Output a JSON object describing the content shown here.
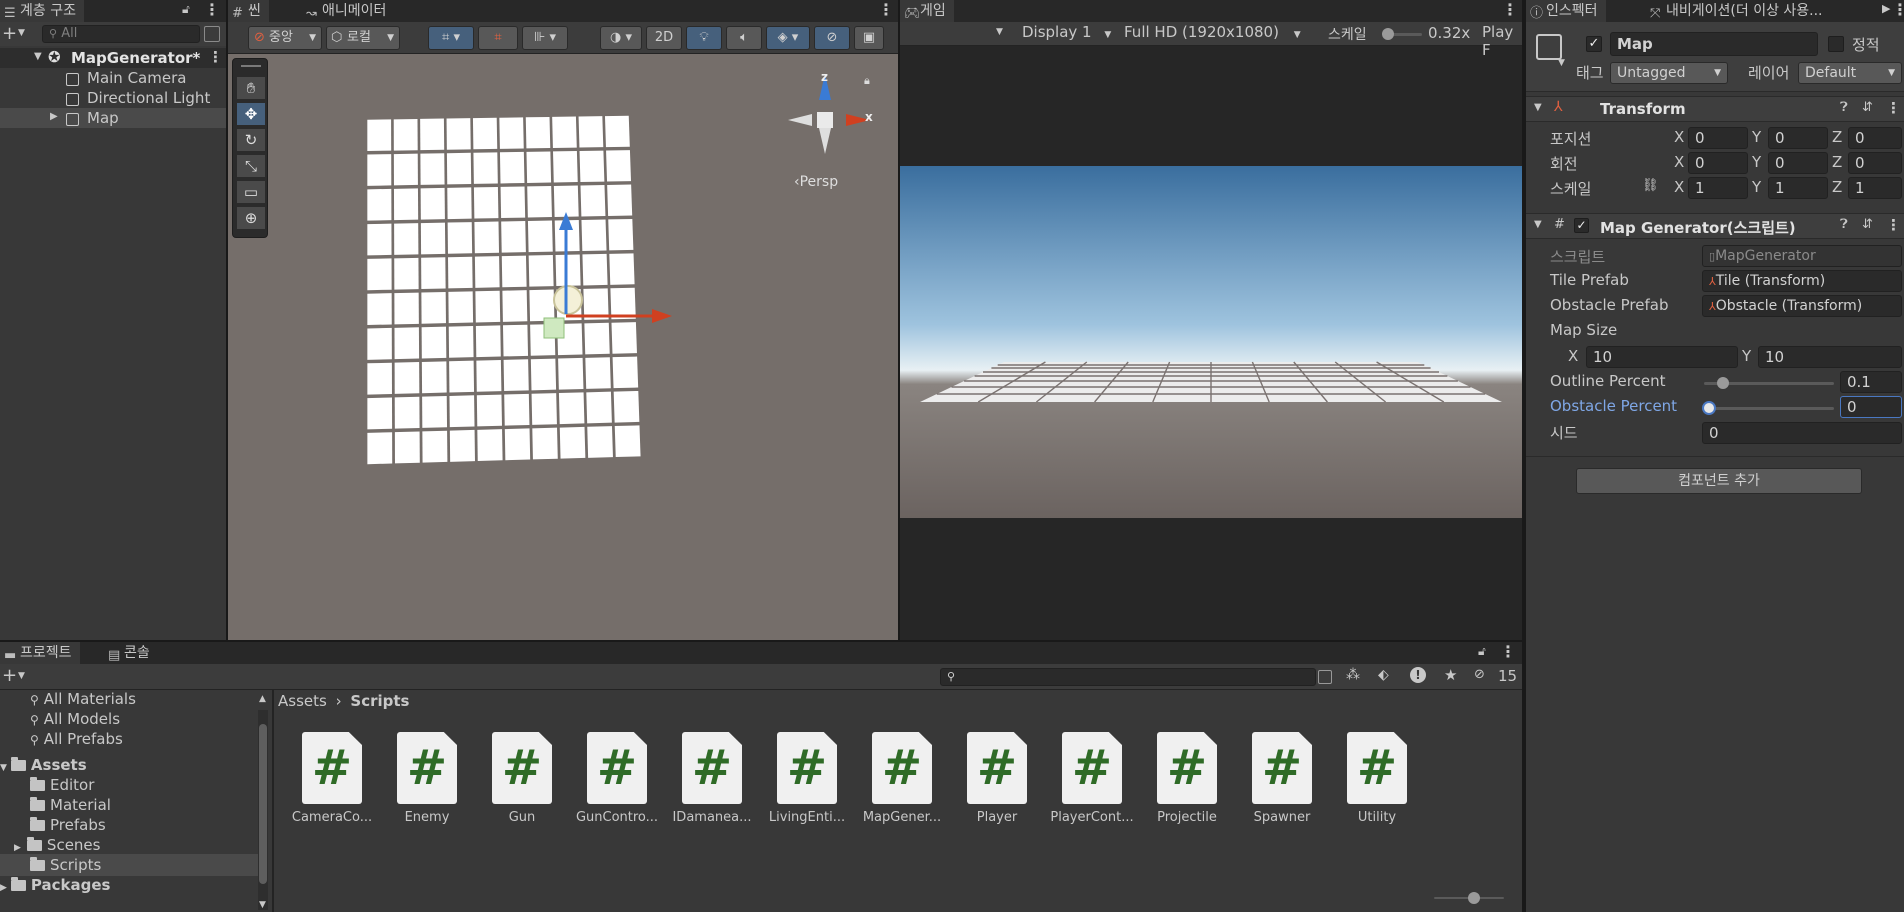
{
  "hierarchy": {
    "tab_label": "계층 구조",
    "search_placeholder": "All",
    "root": "MapGenerator*",
    "items": [
      "Main Camera",
      "Directional Light",
      "Map"
    ]
  },
  "scene": {
    "tab_label": "씬",
    "tab2_label": "애니메이터",
    "pivot_label": "중앙",
    "space_label": "로컬",
    "btn_2d": "2D",
    "persp_label": "Persp",
    "gizmo_x": "x",
    "gizmo_z": "z",
    "tools": [
      "hand-tool-icon",
      "move-tool-icon",
      "rotate-tool-icon",
      "scale-tool-icon",
      "rect-tool-icon",
      "transform-tool-icon"
    ]
  },
  "game": {
    "tab_label": "게임",
    "display": "Display 1",
    "resolution": "Full HD (1920x1080)",
    "scale_label": "스케일",
    "scale_value": "0.32x",
    "play_label": "Play F"
  },
  "inspector": {
    "tab_label": "인스펙터",
    "tab2_label": "내비게이션(더 이상 사용...",
    "object_name": "Map",
    "static_label": "정적",
    "tag_label": "태그",
    "tag_value": "Untagged",
    "layer_label": "레이어",
    "layer_value": "Default",
    "transform": {
      "title": "Transform",
      "rows": [
        {
          "label": "포지션",
          "x": "0",
          "y": "0",
          "z": "0"
        },
        {
          "label": "회전",
          "x": "0",
          "y": "0",
          "z": "0"
        },
        {
          "label": "스케일",
          "x": "1",
          "y": "1",
          "z": "1"
        }
      ],
      "axis_x": "X",
      "axis_y": "Y",
      "axis_z": "Z"
    },
    "script_component": {
      "title": "Map Generator(스크립트)",
      "script_label": "스크립트",
      "script_value": "MapGenerator",
      "tile_prefab_label": "Tile Prefab",
      "tile_prefab_value": "Tile (Transform)",
      "obstacle_prefab_label": "Obstacle Prefab",
      "obstacle_prefab_value": "Obstacle (Transform)",
      "map_size_label": "Map Size",
      "map_size_x": "10",
      "map_size_y": "10",
      "outline_label": "Outline Percent",
      "outline_value": "0.1",
      "outline_fraction": 0.1,
      "obstacle_percent_label": "Obstacle Percent",
      "obstacle_percent_value": "0",
      "obstacle_fraction": 0,
      "seed_label": "시드",
      "seed_value": "0"
    },
    "add_component": "컴포넌트 추가"
  },
  "project": {
    "tab_label": "프로젝트",
    "tab2_label": "콘솔",
    "hidden_count": "15",
    "breadcrumb_root": "Assets",
    "breadcrumb_current": "Scripts",
    "favorites": [
      "All Materials",
      "All Models",
      "All Prefabs"
    ],
    "tree_assets": "Assets",
    "folders": [
      "Editor",
      "Material",
      "Prefabs",
      "Scenes",
      "Scripts"
    ],
    "tree_packages": "Packages",
    "scripts": [
      "CameraCo...",
      "Enemy",
      "Gun",
      "GunContro...",
      "IDamanea...",
      "LivingEnti...",
      "MapGener...",
      "Player",
      "PlayerCont...",
      "Projectile",
      "Spawner",
      "Utility"
    ]
  },
  "colors": {
    "accent_blue": "#46607c",
    "panel_bg": "#383838",
    "script_green": "#2f6b27",
    "sky_top": "#3a6e9e",
    "ground": "#6b6360"
  }
}
